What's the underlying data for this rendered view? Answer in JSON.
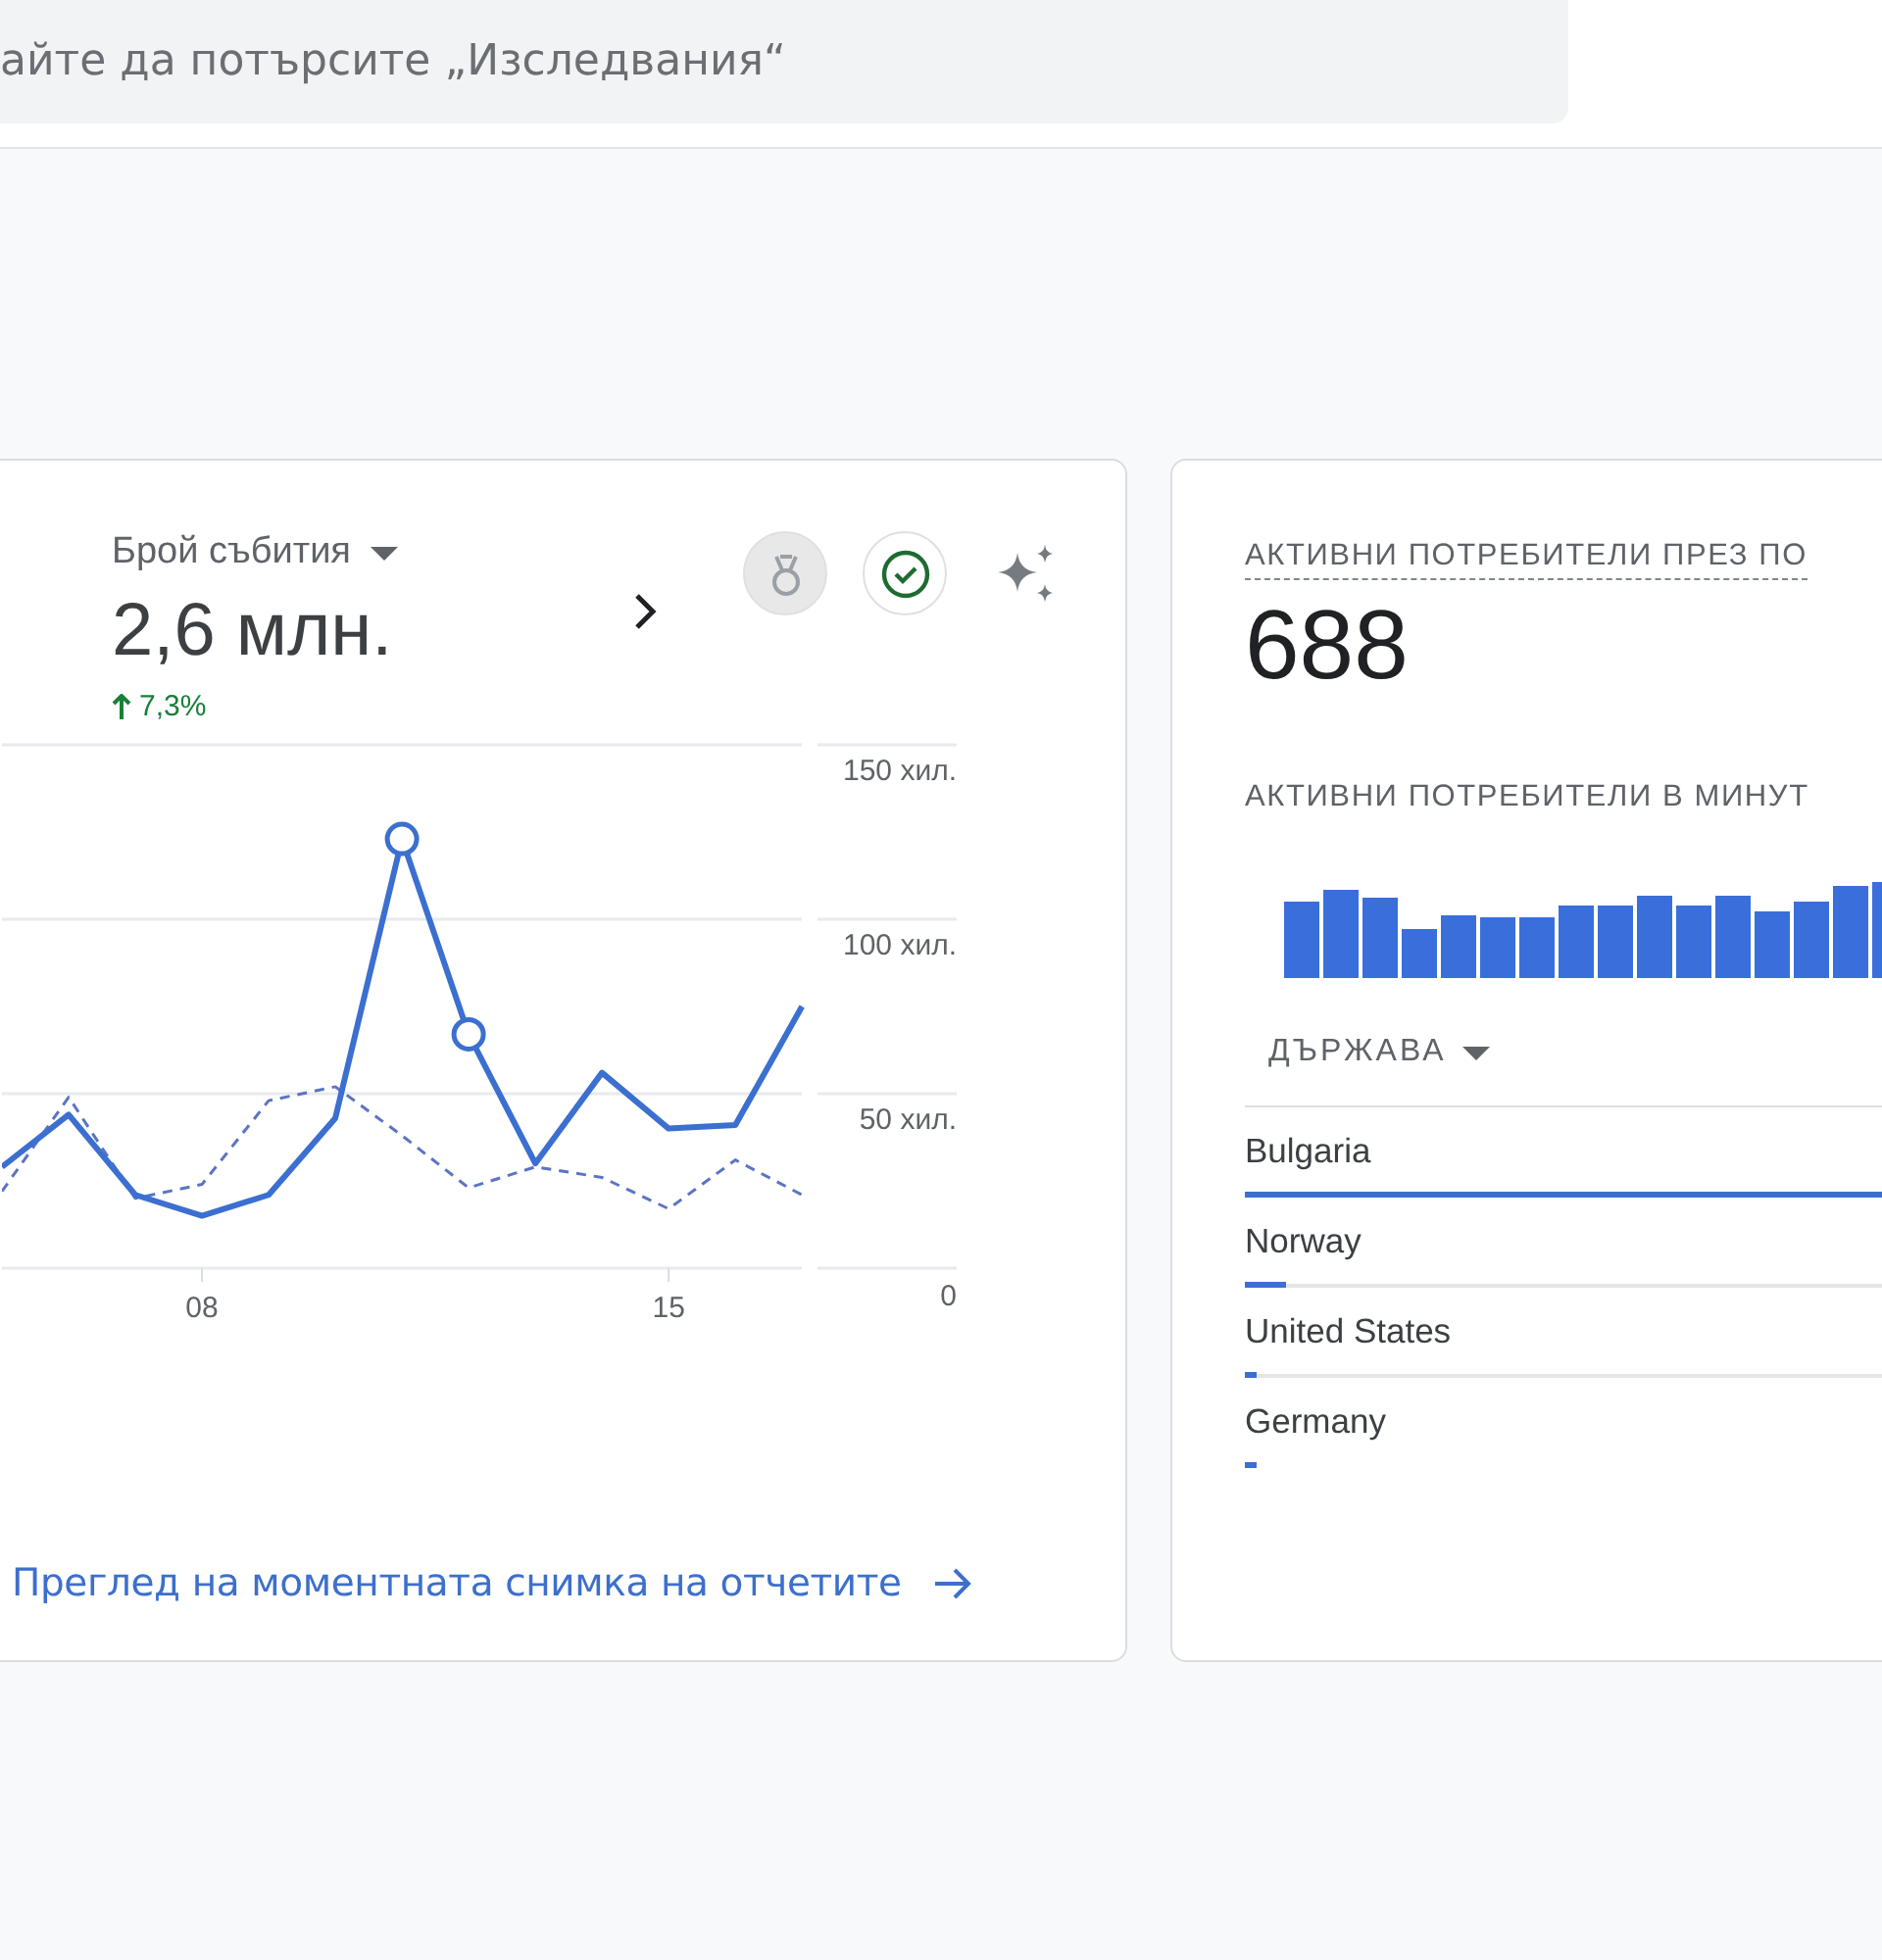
{
  "search": {
    "placeholder": "айте да потърсите „Изследвания“"
  },
  "events_card": {
    "metric": {
      "label": "Брой събития",
      "value": "2,6 млн.",
      "change": "7,3%"
    },
    "chart_data": {
      "type": "line",
      "x": [
        5,
        6,
        7,
        8,
        9,
        10,
        11,
        12,
        13,
        14,
        15,
        16,
        17
      ],
      "series": [
        {
          "color": "#3b6fd0",
          "line_style": "solid",
          "values": [
            29,
            44,
            21,
            15,
            21,
            43,
            123,
            67,
            30,
            56,
            40,
            41,
            75
          ]
        },
        {
          "color": "#5b74c4",
          "line_style": "dashed",
          "values": [
            22,
            49,
            20,
            24,
            48,
            52,
            38,
            23,
            29,
            26,
            17,
            31,
            21
          ]
        }
      ],
      "xlim": [
        5,
        19.32
      ],
      "grid": true,
      "xticks": [
        {
          "value": 8,
          "label": "08"
        },
        {
          "value": 15,
          "label": "15"
        }
      ],
      "ylim": [
        0,
        150
      ],
      "yticks": [
        {
          "value": 0,
          "label": "0"
        },
        {
          "value": 50,
          "label": "50 хил."
        },
        {
          "value": 100,
          "label": "100 хил."
        },
        {
          "value": 150,
          "label": "150 хил."
        }
      ]
    },
    "link": "Преглед на моментната снимка на отчетите"
  },
  "realtime_card": {
    "title": "АКТИВНИ ПОТРЕБИТЕЛИ ПРЕЗ ПО",
    "value": "688",
    "per_minute_title": "АКТИВНИ ПОТРЕБИТЕЛИ В МИНУТ",
    "table": {
      "column": "ДЪРЖАВА",
      "rows": [
        {
          "name": "Bulgaria",
          "level": 1
        },
        {
          "name": "Norway",
          "level": 0.05
        },
        {
          "name": "United States",
          "level": 0.015
        },
        {
          "name": "Germany",
          "level": 0.015
        }
      ]
    }
  }
}
